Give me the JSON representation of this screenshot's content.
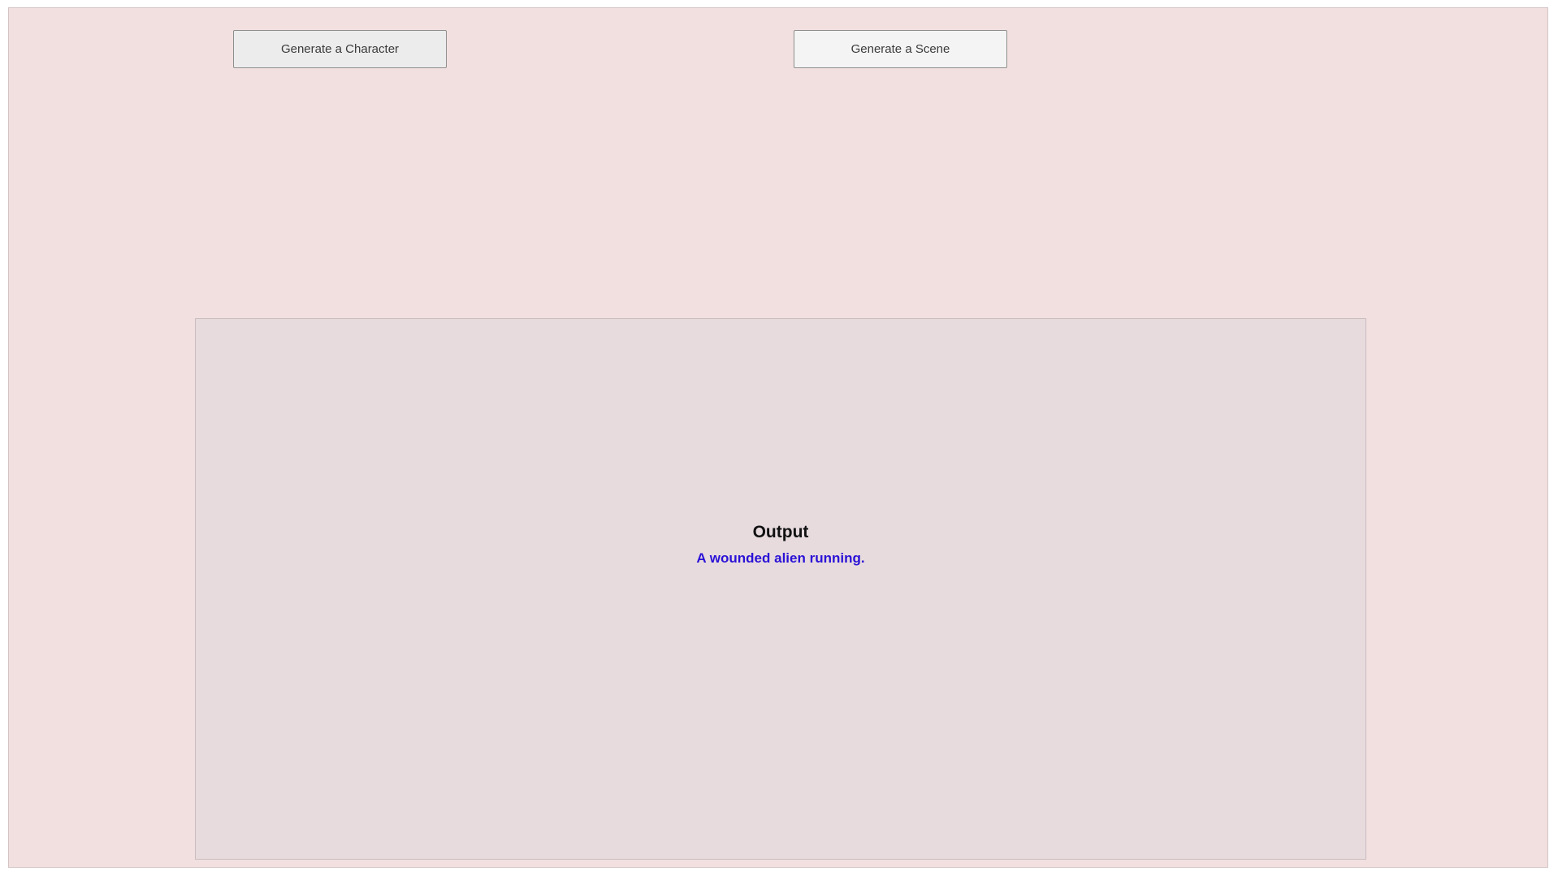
{
  "toolbar": {
    "character_button_label": "Generate a Character",
    "scene_button_label": "Generate a Scene"
  },
  "output": {
    "title": "Output",
    "text": "A wounded alien running.",
    "text_color": "#2a12d6"
  },
  "colors": {
    "background": "#f2e0e0",
    "panel": "#e7dbde"
  }
}
